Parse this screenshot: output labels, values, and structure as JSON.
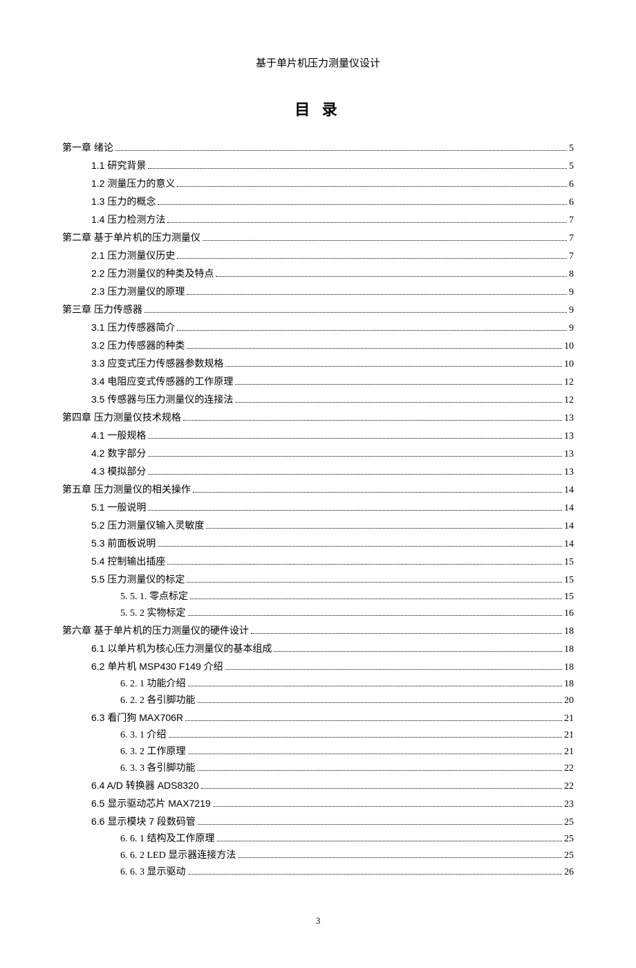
{
  "header_title": "基于单片机压力测量仪设计",
  "toc_title": "目 录",
  "footer_page": "3",
  "entries": [
    {
      "level": 1,
      "label": "第一章  绪论",
      "page": "5",
      "bold": true
    },
    {
      "level": 2,
      "label": "1.1 研究背景",
      "page": "5",
      "bold": true
    },
    {
      "level": 2,
      "label": "1.2 测量压力的意义",
      "page": "6",
      "bold": true
    },
    {
      "level": 2,
      "label": "1.3 压力的概念",
      "page": "6",
      "bold": true
    },
    {
      "level": 2,
      "label": "1.4 压力检测方法",
      "page": "7",
      "bold": true
    },
    {
      "level": 1,
      "label": "第二章 基于单片机的压力测量仪",
      "page": "7",
      "bold": true
    },
    {
      "level": 2,
      "label": "2.1 压力测量仪历史",
      "page": "7",
      "bold": true
    },
    {
      "level": 2,
      "label": "2.2 压力测量仪的种类及特点",
      "page": "8",
      "bold": true
    },
    {
      "level": 2,
      "label": "2.3 压力测量仪的原理",
      "page": "9",
      "bold": true
    },
    {
      "level": 1,
      "label": "第三章 压力传感器",
      "page": "9",
      "bold": true
    },
    {
      "level": 2,
      "label": "3.1 压力传感器简介",
      "page": "9",
      "bold": true
    },
    {
      "level": 2,
      "label": "3.2 压力传感器的种类",
      "page": "10",
      "bold": true
    },
    {
      "level": 2,
      "label": "3.3 应变式压力传感器参数规格",
      "page": "10",
      "bold": true
    },
    {
      "level": 2,
      "label": "3.4 电阻应变式传感器的工作原理",
      "page": "12",
      "bold": true
    },
    {
      "level": 2,
      "label": "3.5 传感器与压力测量仪的连接法",
      "page": "12",
      "bold": true
    },
    {
      "level": 1,
      "label": "第四章 压力测量仪技术规格",
      "page": "13",
      "bold": true
    },
    {
      "level": 2,
      "label": "4.1 一般规格",
      "page": "13",
      "bold": true
    },
    {
      "level": 2,
      "label": "4.2 数字部分",
      "page": "13",
      "bold": true
    },
    {
      "level": 2,
      "label": "4.3 模拟部分",
      "page": "13",
      "bold": true
    },
    {
      "level": 1,
      "label": "第五章 压力测量仪的相关操作",
      "page": "14",
      "bold": true
    },
    {
      "level": 2,
      "label": "5.1 一般说明",
      "page": "14",
      "bold": true
    },
    {
      "level": 2,
      "label": "5.2 压力测量仪输入灵敏度",
      "page": "14",
      "bold": true
    },
    {
      "level": 2,
      "label": "5.3 前面板说明",
      "page": "14",
      "bold": true
    },
    {
      "level": 2,
      "label": "5.4 控制输出插座",
      "page": "15",
      "bold": true
    },
    {
      "level": 2,
      "label": "5.5 压力测量仪的标定",
      "page": "15",
      "bold": true
    },
    {
      "level": 3,
      "label": "5. 5. 1. 零点标定",
      "page": "15",
      "bold": false
    },
    {
      "level": 3,
      "label": "5. 5. 2 实物标定",
      "page": "16",
      "bold": false
    },
    {
      "level": 1,
      "label": "第六章 基于单片机的压力测量仪的硬件设计",
      "page": "18",
      "bold": true
    },
    {
      "level": 2,
      "label": "6.1 以单片机为核心压力测量仪的基本组成",
      "page": "18",
      "bold": true
    },
    {
      "level": 2,
      "label": "6.2 单片机 MSP430 F149 介绍",
      "page": "18",
      "bold": true
    },
    {
      "level": 3,
      "label": "6. 2. 1 功能介绍",
      "page": "18",
      "bold": false
    },
    {
      "level": 3,
      "label": "6. 2. 2 各引脚功能",
      "page": "20",
      "bold": false
    },
    {
      "level": 2,
      "label": "6.3 看门狗 MAX706R",
      "page": "21",
      "bold": true
    },
    {
      "level": 3,
      "label": "6. 3. 1 介绍",
      "page": "21",
      "bold": false
    },
    {
      "level": 3,
      "label": "6. 3. 2 工作原理",
      "page": "21",
      "bold": false
    },
    {
      "level": 3,
      "label": "6. 3. 3 各引脚功能",
      "page": "22",
      "bold": false
    },
    {
      "level": 2,
      "label": "6.4 A/D 转换器 ADS8320",
      "page": "22",
      "bold": true
    },
    {
      "level": 2,
      "label": "6.5 显示驱动芯片 MAX7219",
      "page": "23",
      "bold": true
    },
    {
      "level": 2,
      "label": "6.6 显示模块 7 段数码管",
      "page": "25",
      "bold": true
    },
    {
      "level": 3,
      "label": "6. 6. 1 结构及工作原理",
      "page": "25",
      "bold": false
    },
    {
      "level": 3,
      "label": "6. 6. 2 LED 显示器连接方法",
      "page": "25",
      "bold": false
    },
    {
      "level": 3,
      "label": "6. 6. 3 显示驱动",
      "page": "26",
      "bold": false
    }
  ]
}
